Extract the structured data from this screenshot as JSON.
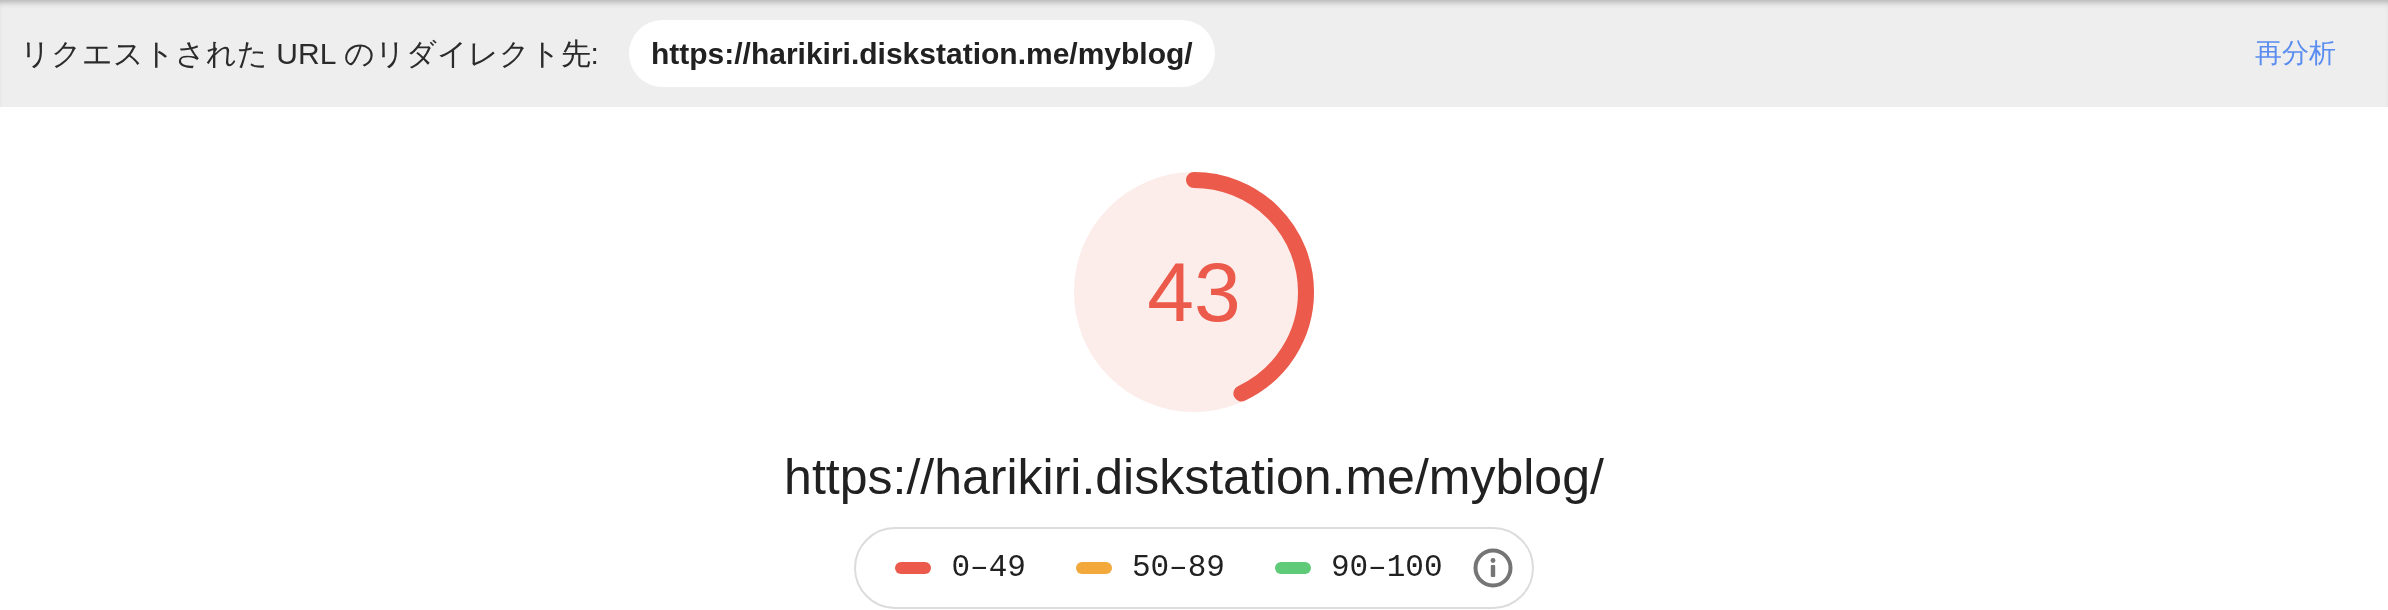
{
  "redirect_bar": {
    "label": "リクエストされた URL のリダイレクト先:",
    "url": "https://harikiri.diskstation.me/myblog/",
    "reanalyze_link": "再分析"
  },
  "score": {
    "value": "43",
    "level": 0.43
  },
  "page_url": "https://harikiri.diskstation.me/myblog/",
  "legend": {
    "items": [
      {
        "label": "0–49",
        "color": "#eb5a4a"
      },
      {
        "label": "50–89",
        "color": "#f2a83b"
      },
      {
        "label": "90–100",
        "color": "#5fcb78"
      }
    ]
  }
}
